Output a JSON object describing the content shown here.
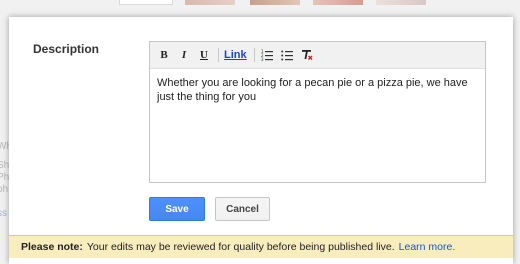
{
  "description_label": "Description",
  "toolbar": {
    "bold": "B",
    "italic": "I",
    "underline": "U",
    "link": "Link",
    "icons": [
      "numbered-list-icon",
      "bulleted-list-icon",
      "remove-formatting-icon"
    ]
  },
  "editor": {
    "text": "Whether you are looking for a pecan pie or a pizza pie, we have just the thing for you"
  },
  "buttons": {
    "save": "Save",
    "cancel": "Cancel"
  },
  "note": {
    "label": "Please note:",
    "text": "Your edits may be reviewed for quality before being published live.",
    "link": "Learn more."
  },
  "background_fragments": [
    "Wh",
    "Sh",
    "Ph",
    "ph",
    "ss"
  ],
  "colors": {
    "accent": "#4d90fe",
    "note_bg": "#f9edbe",
    "link": "#1155cc"
  }
}
